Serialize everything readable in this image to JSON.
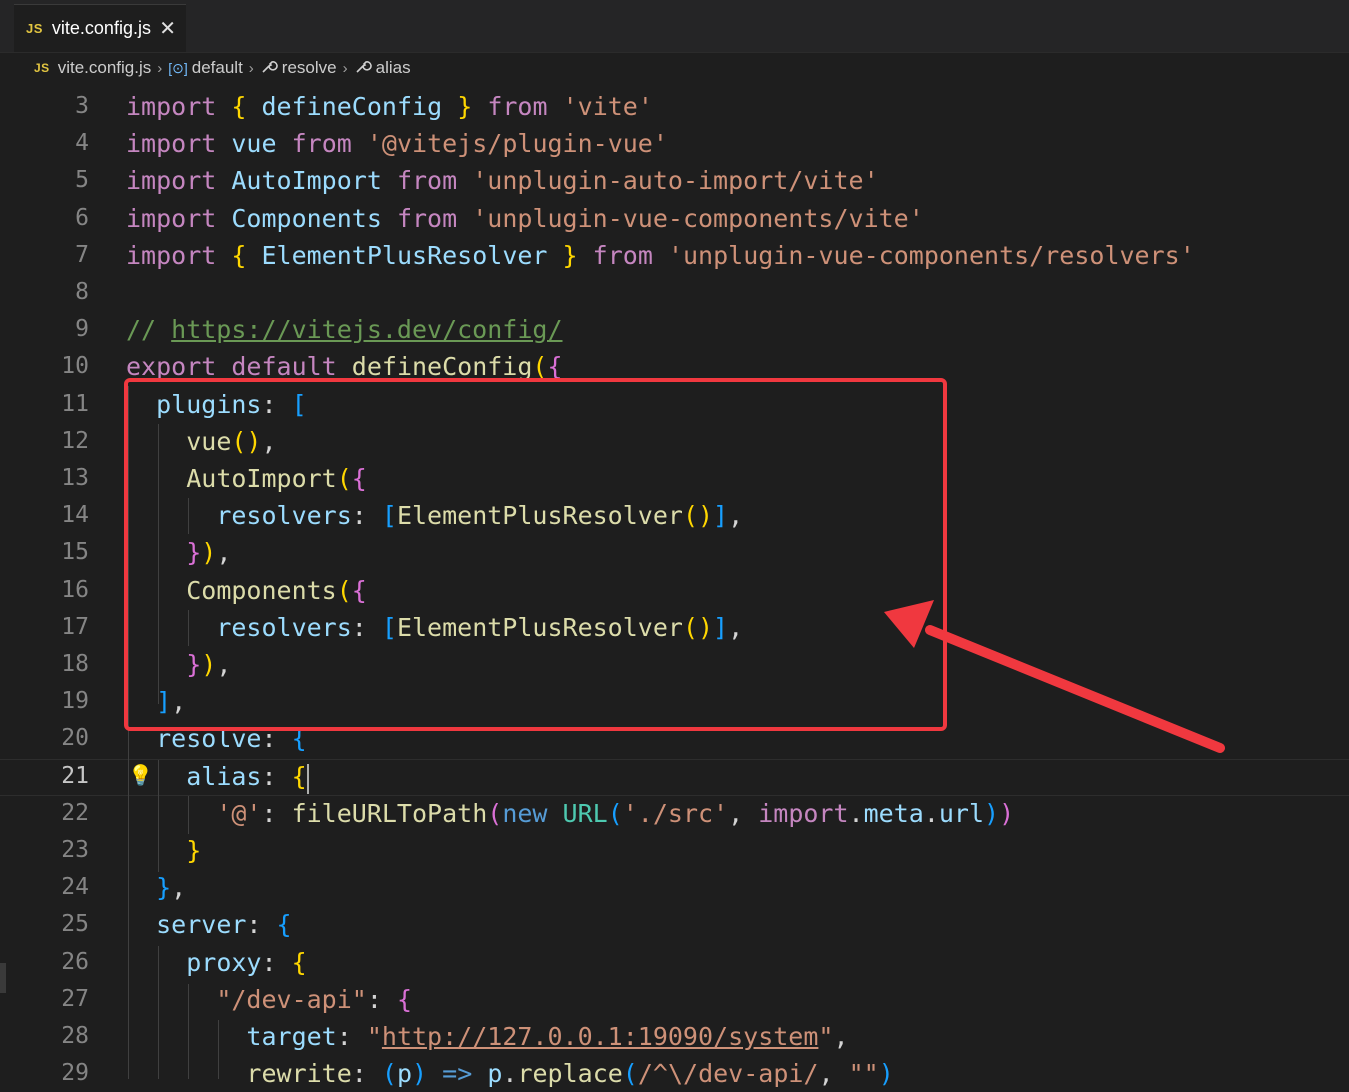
{
  "tab": {
    "badge": "JS",
    "filename": "vite.config.js",
    "close": "✕"
  },
  "breadcrumb": {
    "badge": "JS",
    "file": "vite.config.js",
    "default_icon": "[⊙]",
    "default": "default",
    "resolve": "resolve",
    "alias": "alias",
    "sep": "›"
  },
  "icons": {
    "close": "close-icon",
    "symbol_variable": "symbol-variable-icon",
    "wrench": "wrench-icon",
    "lightbulb": "lightbulb-icon"
  },
  "colors": {
    "highlight_box": "#f0383f",
    "arrow": "#f0383f"
  },
  "lines": [
    {
      "n": "3",
      "p": [
        [
          "k",
          "import"
        ],
        [
          "d",
          " "
        ],
        [
          "b1",
          "{"
        ],
        [
          "d",
          " "
        ],
        [
          "v",
          "defineConfig"
        ],
        [
          "d",
          " "
        ],
        [
          "b1",
          "}"
        ],
        [
          "d",
          " "
        ],
        [
          "k",
          "from"
        ],
        [
          "d",
          " "
        ],
        [
          "s",
          "'vite'"
        ]
      ]
    },
    {
      "n": "4",
      "p": [
        [
          "k",
          "import"
        ],
        [
          "d",
          " "
        ],
        [
          "v",
          "vue"
        ],
        [
          "d",
          " "
        ],
        [
          "k",
          "from"
        ],
        [
          "d",
          " "
        ],
        [
          "s",
          "'@vitejs/plugin-vue'"
        ]
      ]
    },
    {
      "n": "5",
      "p": [
        [
          "k",
          "import"
        ],
        [
          "d",
          " "
        ],
        [
          "v",
          "AutoImport"
        ],
        [
          "d",
          " "
        ],
        [
          "k",
          "from"
        ],
        [
          "d",
          " "
        ],
        [
          "s",
          "'unplugin-auto-import/vite'"
        ]
      ]
    },
    {
      "n": "6",
      "p": [
        [
          "k",
          "import"
        ],
        [
          "d",
          " "
        ],
        [
          "v",
          "Components"
        ],
        [
          "d",
          " "
        ],
        [
          "k",
          "from"
        ],
        [
          "d",
          " "
        ],
        [
          "s",
          "'unplugin-vue-components/vite'"
        ]
      ]
    },
    {
      "n": "7",
      "p": [
        [
          "k",
          "import"
        ],
        [
          "d",
          " "
        ],
        [
          "b1",
          "{"
        ],
        [
          "d",
          " "
        ],
        [
          "v",
          "ElementPlusResolver"
        ],
        [
          "d",
          " "
        ],
        [
          "b1",
          "}"
        ],
        [
          "d",
          " "
        ],
        [
          "k",
          "from"
        ],
        [
          "d",
          " "
        ],
        [
          "s",
          "'unplugin-vue-components/resolvers'"
        ]
      ]
    },
    {
      "n": "8",
      "p": []
    },
    {
      "n": "9",
      "p": [
        [
          "c",
          "// "
        ],
        [
          "cl",
          "https://vitejs.dev/config/"
        ]
      ]
    },
    {
      "n": "10",
      "p": [
        [
          "k",
          "export"
        ],
        [
          "d",
          " "
        ],
        [
          "k",
          "default"
        ],
        [
          "d",
          " "
        ],
        [
          "f",
          "defineConfig"
        ],
        [
          "b1",
          "("
        ],
        [
          "b2",
          "{"
        ]
      ]
    },
    {
      "n": "11",
      "p": [
        [
          "d",
          "  "
        ],
        [
          "v",
          "plugins"
        ],
        [
          "d",
          ": "
        ],
        [
          "b3",
          "["
        ]
      ]
    },
    {
      "n": "12",
      "p": [
        [
          "d",
          "    "
        ],
        [
          "f",
          "vue"
        ],
        [
          "b1",
          "()"
        ],
        [
          "d",
          ","
        ]
      ]
    },
    {
      "n": "13",
      "p": [
        [
          "d",
          "    "
        ],
        [
          "f",
          "AutoImport"
        ],
        [
          "b1",
          "("
        ],
        [
          "b2",
          "{"
        ]
      ]
    },
    {
      "n": "14",
      "p": [
        [
          "d",
          "      "
        ],
        [
          "v",
          "resolvers"
        ],
        [
          "d",
          ": "
        ],
        [
          "b3",
          "["
        ],
        [
          "f",
          "ElementPlusResolver"
        ],
        [
          "b1",
          "()"
        ],
        [
          "b3",
          "]"
        ],
        [
          "d",
          ","
        ]
      ]
    },
    {
      "n": "15",
      "p": [
        [
          "d",
          "    "
        ],
        [
          "b2",
          "}"
        ],
        [
          "b1",
          ")"
        ],
        [
          "d",
          ","
        ]
      ]
    },
    {
      "n": "16",
      "p": [
        [
          "d",
          "    "
        ],
        [
          "f",
          "Components"
        ],
        [
          "b1",
          "("
        ],
        [
          "b2",
          "{"
        ]
      ]
    },
    {
      "n": "17",
      "p": [
        [
          "d",
          "      "
        ],
        [
          "v",
          "resolvers"
        ],
        [
          "d",
          ": "
        ],
        [
          "b3",
          "["
        ],
        [
          "f",
          "ElementPlusResolver"
        ],
        [
          "b1",
          "()"
        ],
        [
          "b3",
          "]"
        ],
        [
          "d",
          ","
        ]
      ]
    },
    {
      "n": "18",
      "p": [
        [
          "d",
          "    "
        ],
        [
          "b2",
          "}"
        ],
        [
          "b1",
          ")"
        ],
        [
          "d",
          ","
        ]
      ]
    },
    {
      "n": "19",
      "p": [
        [
          "d",
          "  "
        ],
        [
          "b3",
          "]"
        ],
        [
          "d",
          ","
        ]
      ]
    },
    {
      "n": "20",
      "p": [
        [
          "d",
          "  "
        ],
        [
          "v",
          "resolve"
        ],
        [
          "d",
          ": "
        ],
        [
          "b3",
          "{"
        ]
      ]
    },
    {
      "n": "21",
      "p": [
        [
          "d",
          "    "
        ],
        [
          "v",
          "alias"
        ],
        [
          "d",
          ": "
        ],
        [
          "b1",
          "{"
        ]
      ],
      "active": true
    },
    {
      "n": "22",
      "p": [
        [
          "d",
          "      "
        ],
        [
          "s",
          "'@'"
        ],
        [
          "d",
          ": "
        ],
        [
          "f",
          "fileURLToPath"
        ],
        [
          "b2",
          "("
        ],
        [
          "bl",
          "new"
        ],
        [
          "d",
          " "
        ],
        [
          "t",
          "URL"
        ],
        [
          "b3",
          "("
        ],
        [
          "s",
          "'./src'"
        ],
        [
          "d",
          ", "
        ],
        [
          "k",
          "import"
        ],
        [
          "d",
          "."
        ],
        [
          "v",
          "meta"
        ],
        [
          "d",
          "."
        ],
        [
          "v",
          "url"
        ],
        [
          "b3",
          ")"
        ],
        [
          "b2",
          ")"
        ]
      ]
    },
    {
      "n": "23",
      "p": [
        [
          "d",
          "    "
        ],
        [
          "b1",
          "}"
        ]
      ]
    },
    {
      "n": "24",
      "p": [
        [
          "d",
          "  "
        ],
        [
          "b3",
          "}"
        ],
        [
          "d",
          ","
        ]
      ]
    },
    {
      "n": "25",
      "p": [
        [
          "d",
          "  "
        ],
        [
          "v",
          "server"
        ],
        [
          "d",
          ": "
        ],
        [
          "b3",
          "{"
        ]
      ]
    },
    {
      "n": "26",
      "p": [
        [
          "d",
          "    "
        ],
        [
          "v",
          "proxy"
        ],
        [
          "d",
          ": "
        ],
        [
          "b1",
          "{"
        ]
      ]
    },
    {
      "n": "27",
      "p": [
        [
          "d",
          "      "
        ],
        [
          "s",
          "\"/dev-api\""
        ],
        [
          "d",
          ": "
        ],
        [
          "b2",
          "{"
        ]
      ]
    },
    {
      "n": "28",
      "p": [
        [
          "d",
          "        "
        ],
        [
          "v",
          "target"
        ],
        [
          "d",
          ": "
        ],
        [
          "s",
          "\""
        ],
        [
          "sl",
          "http://127.0.0.1:19090/system"
        ],
        [
          "s",
          "\""
        ],
        [
          "d",
          ","
        ]
      ]
    },
    {
      "n": "29",
      "p": [
        [
          "d",
          "        "
        ],
        [
          "f",
          "rewrite"
        ],
        [
          "d",
          ": "
        ],
        [
          "b3",
          "("
        ],
        [
          "v",
          "p"
        ],
        [
          "b3",
          ")"
        ],
        [
          "d",
          " "
        ],
        [
          "bl",
          "=>"
        ],
        [
          "d",
          " "
        ],
        [
          "v",
          "p"
        ],
        [
          "d",
          "."
        ],
        [
          "f",
          "replace"
        ],
        [
          "b3",
          "("
        ],
        [
          "s",
          "/^\\/dev-api/"
        ],
        [
          "d",
          ", "
        ],
        [
          "s",
          "\"\""
        ],
        [
          "b3",
          ")"
        ]
      ]
    }
  ]
}
